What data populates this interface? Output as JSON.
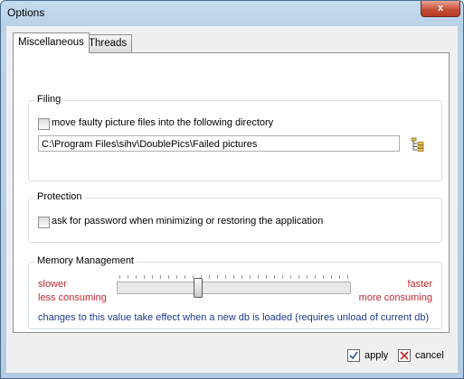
{
  "window": {
    "title": "Options",
    "close_glyph": "x"
  },
  "tabs": [
    {
      "label": "Miscellaneous",
      "active": true
    },
    {
      "label": "Threads",
      "active": false
    }
  ],
  "filing": {
    "group_label": "Filing",
    "checkbox_label": "move faulty picture files into the following directory",
    "checked": false,
    "directory_value": "C:\\Program Files\\sihv\\DoublePics\\Failed pictures",
    "browse_icon": "folder-tree-icon"
  },
  "protection": {
    "group_label": "Protection",
    "checkbox_label": "ask for password when minimizing or restoring the application",
    "checked": false
  },
  "memory": {
    "group_label": "Memory Management",
    "left_top": "slower",
    "left_bottom": "less consuming",
    "right_top": "faster",
    "right_bottom": "more consuming",
    "slider_level": 0.35,
    "note": "changes to this value take effect when a new db is loaded (requires unload of current db)",
    "label_color": "#c0292f",
    "note_color": "#1d3a8a"
  },
  "buttons": {
    "apply_label": "apply",
    "cancel_label": "cancel"
  }
}
